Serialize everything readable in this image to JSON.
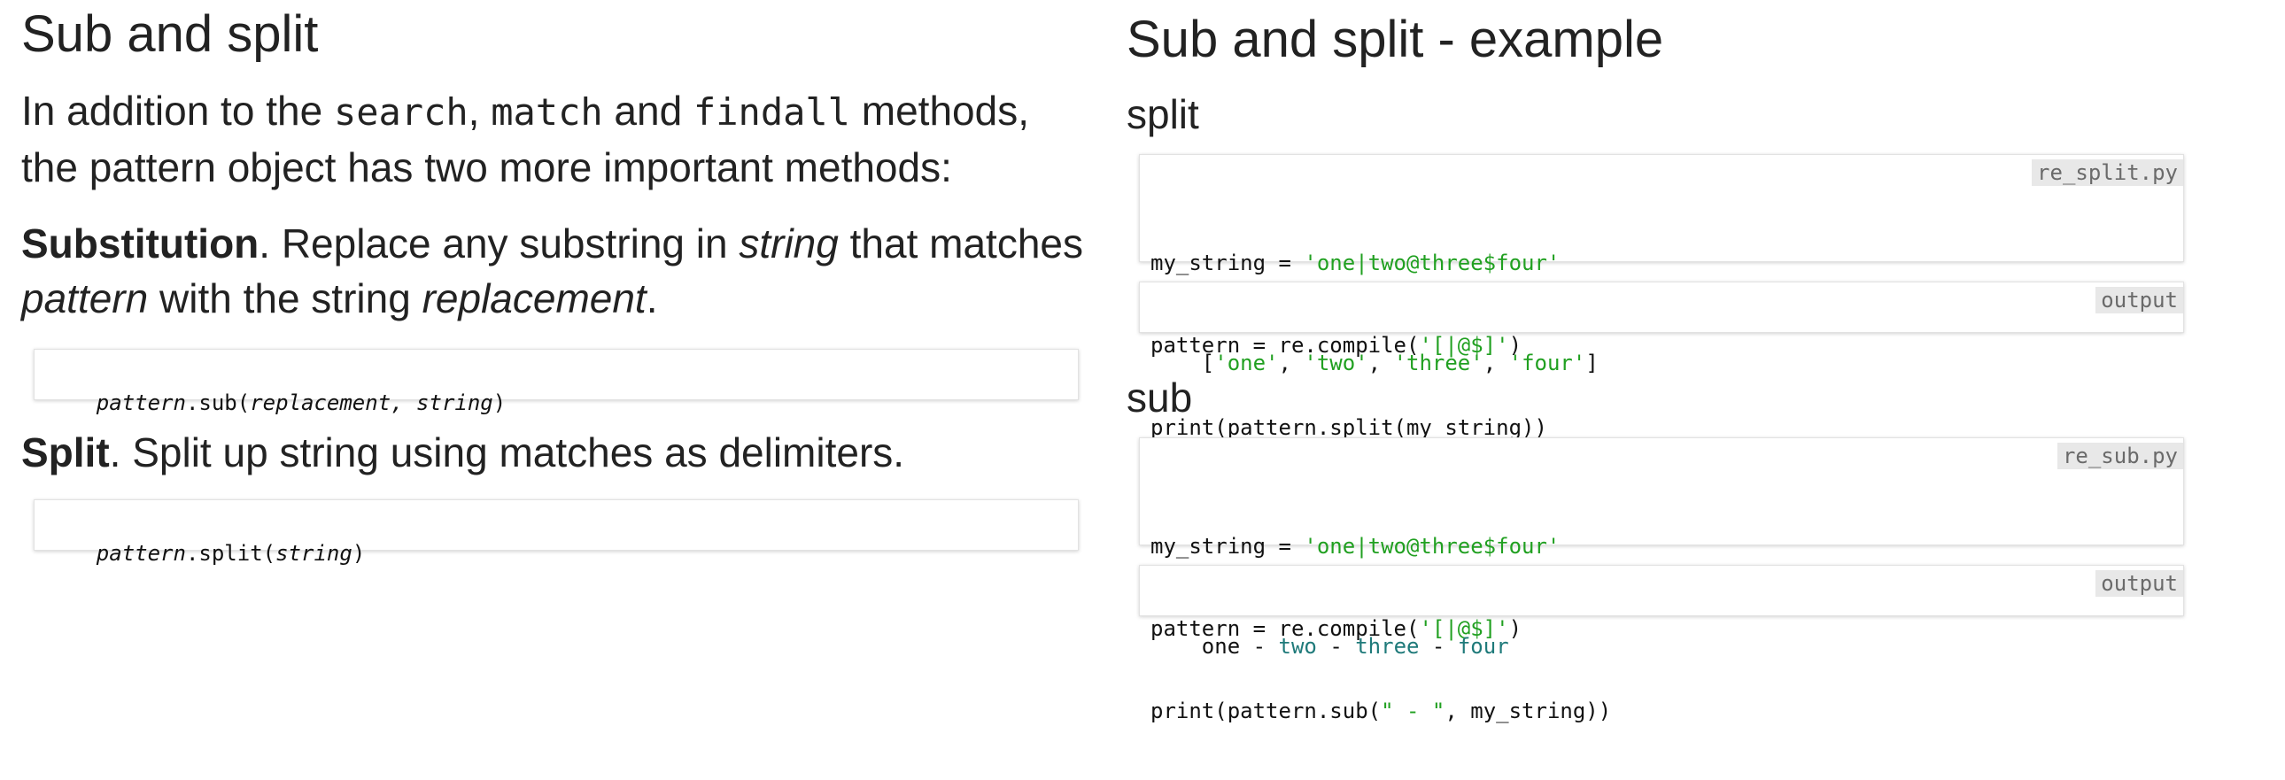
{
  "left": {
    "title": "Sub and split",
    "intro": {
      "t1": "In addition to the ",
      "c1": "search",
      "t2": ", ",
      "c2": "match",
      "t3": " and ",
      "c3": "findall",
      "t4": " methods, the pattern object has two more important methods:"
    },
    "substitution": {
      "bold": "Substitution",
      "t1": ". Replace any substring in ",
      "i1": "string",
      "t2": " that matches ",
      "i2": "pattern",
      "t3": " with the string ",
      "i3": "replacement",
      "t4": "."
    },
    "sub_signature": {
      "obj": "pattern",
      "method": ".sub(",
      "arg1": "replacement, string",
      "close": ")"
    },
    "split": {
      "bold": "Split",
      "text": ". Split up string using matches as delimiters."
    },
    "split_signature": {
      "obj": "pattern",
      "method": ".split(",
      "arg1": "string",
      "close": ")"
    }
  },
  "right": {
    "title": "Sub and split - example",
    "split_heading": "split",
    "split_file": "re_split.py",
    "split_code": {
      "l1a": "my_string = ",
      "l1s": "'one|two@three$four'",
      "l2a": "pattern = re.compile(",
      "l2s": "'[|@$]'",
      "l2b": ")",
      "l3": "print(pattern.split(my_string))"
    },
    "split_output_tag": "output",
    "split_output": {
      "o": "[",
      "s1": "'one'",
      "c1": ", ",
      "s2": "'two'",
      "c2": ", ",
      "s3": "'three'",
      "c3": ", ",
      "s4": "'four'",
      "e": "]"
    },
    "sub_heading": "sub",
    "sub_file": "re_sub.py",
    "sub_code": {
      "l1a": "my_string = ",
      "l1s": "'one|two@three$four'",
      "l2a": "pattern = re.compile(",
      "l2s": "'[|@$]'",
      "l2b": ")",
      "l3a": "print(pattern.sub(",
      "l3s": "\" - \"",
      "l3b": ", my_string))"
    },
    "sub_output_tag": "output",
    "sub_output": {
      "w1": "one",
      "d1": " - ",
      "w2": "two",
      "d2": " - ",
      "w3": "three",
      "d3": " - ",
      "w4": "four"
    }
  }
}
